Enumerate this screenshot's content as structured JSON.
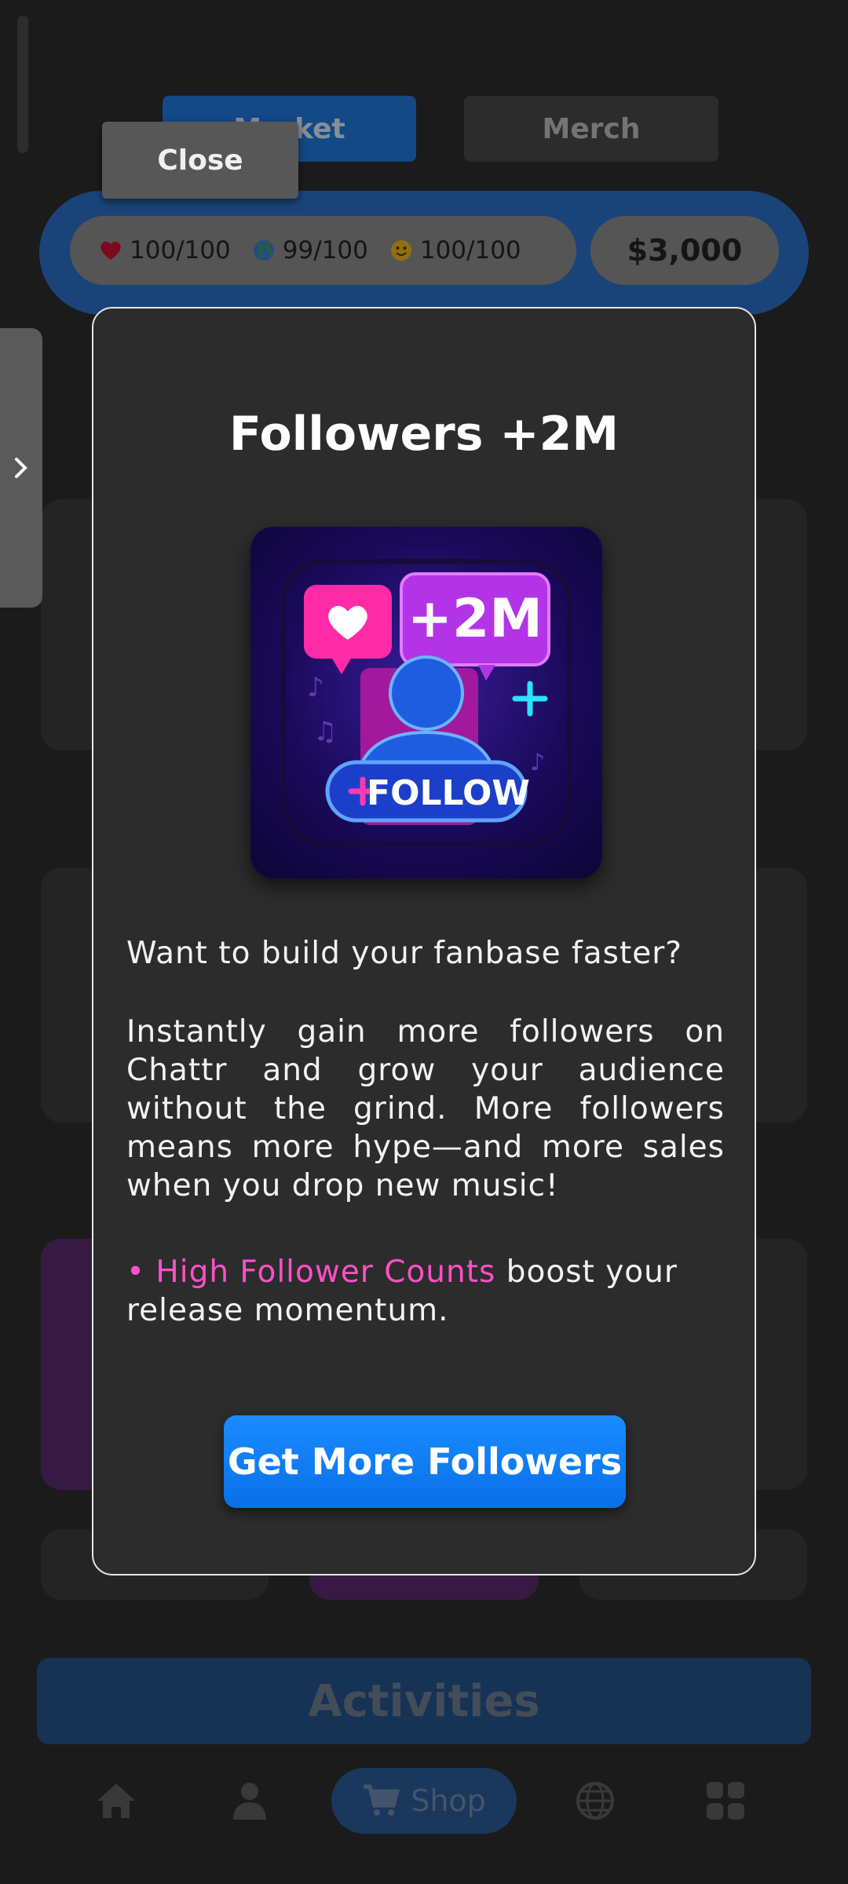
{
  "header": {
    "tabs": [
      {
        "label": "Market",
        "active": true
      },
      {
        "label": "Merch",
        "active": false
      }
    ],
    "close_label": "Close"
  },
  "stats": {
    "health": "100/100",
    "world": "99/100",
    "happiness": "100/100",
    "money": "$3,000"
  },
  "background": {
    "activities_label": "Activities",
    "shop_label": "Shop"
  },
  "modal": {
    "title": "Followers +2M",
    "hero_badge": "+2M",
    "hero_follow": "FOLLOW",
    "intro": "Want to build your fanbase faster?",
    "body": "Instantly gain more followers on Chattr and grow your audience without the grind. More followers means more hype—and more sales when you drop new music!",
    "bullet_highlight": "• High Follower Counts",
    "bullet_rest": " boost your release momentum.",
    "cta_label": "Get More Followers"
  },
  "colors": {
    "accent": "#0a7cff",
    "highlight": "#ff4fc8",
    "modal_bg": "#2c2c2c"
  },
  "icons": [
    "heart-icon",
    "globe-icon",
    "smiley-icon",
    "chevron-right-icon",
    "home-icon",
    "user-icon",
    "cart-icon",
    "world-icon",
    "grid-icon"
  ]
}
